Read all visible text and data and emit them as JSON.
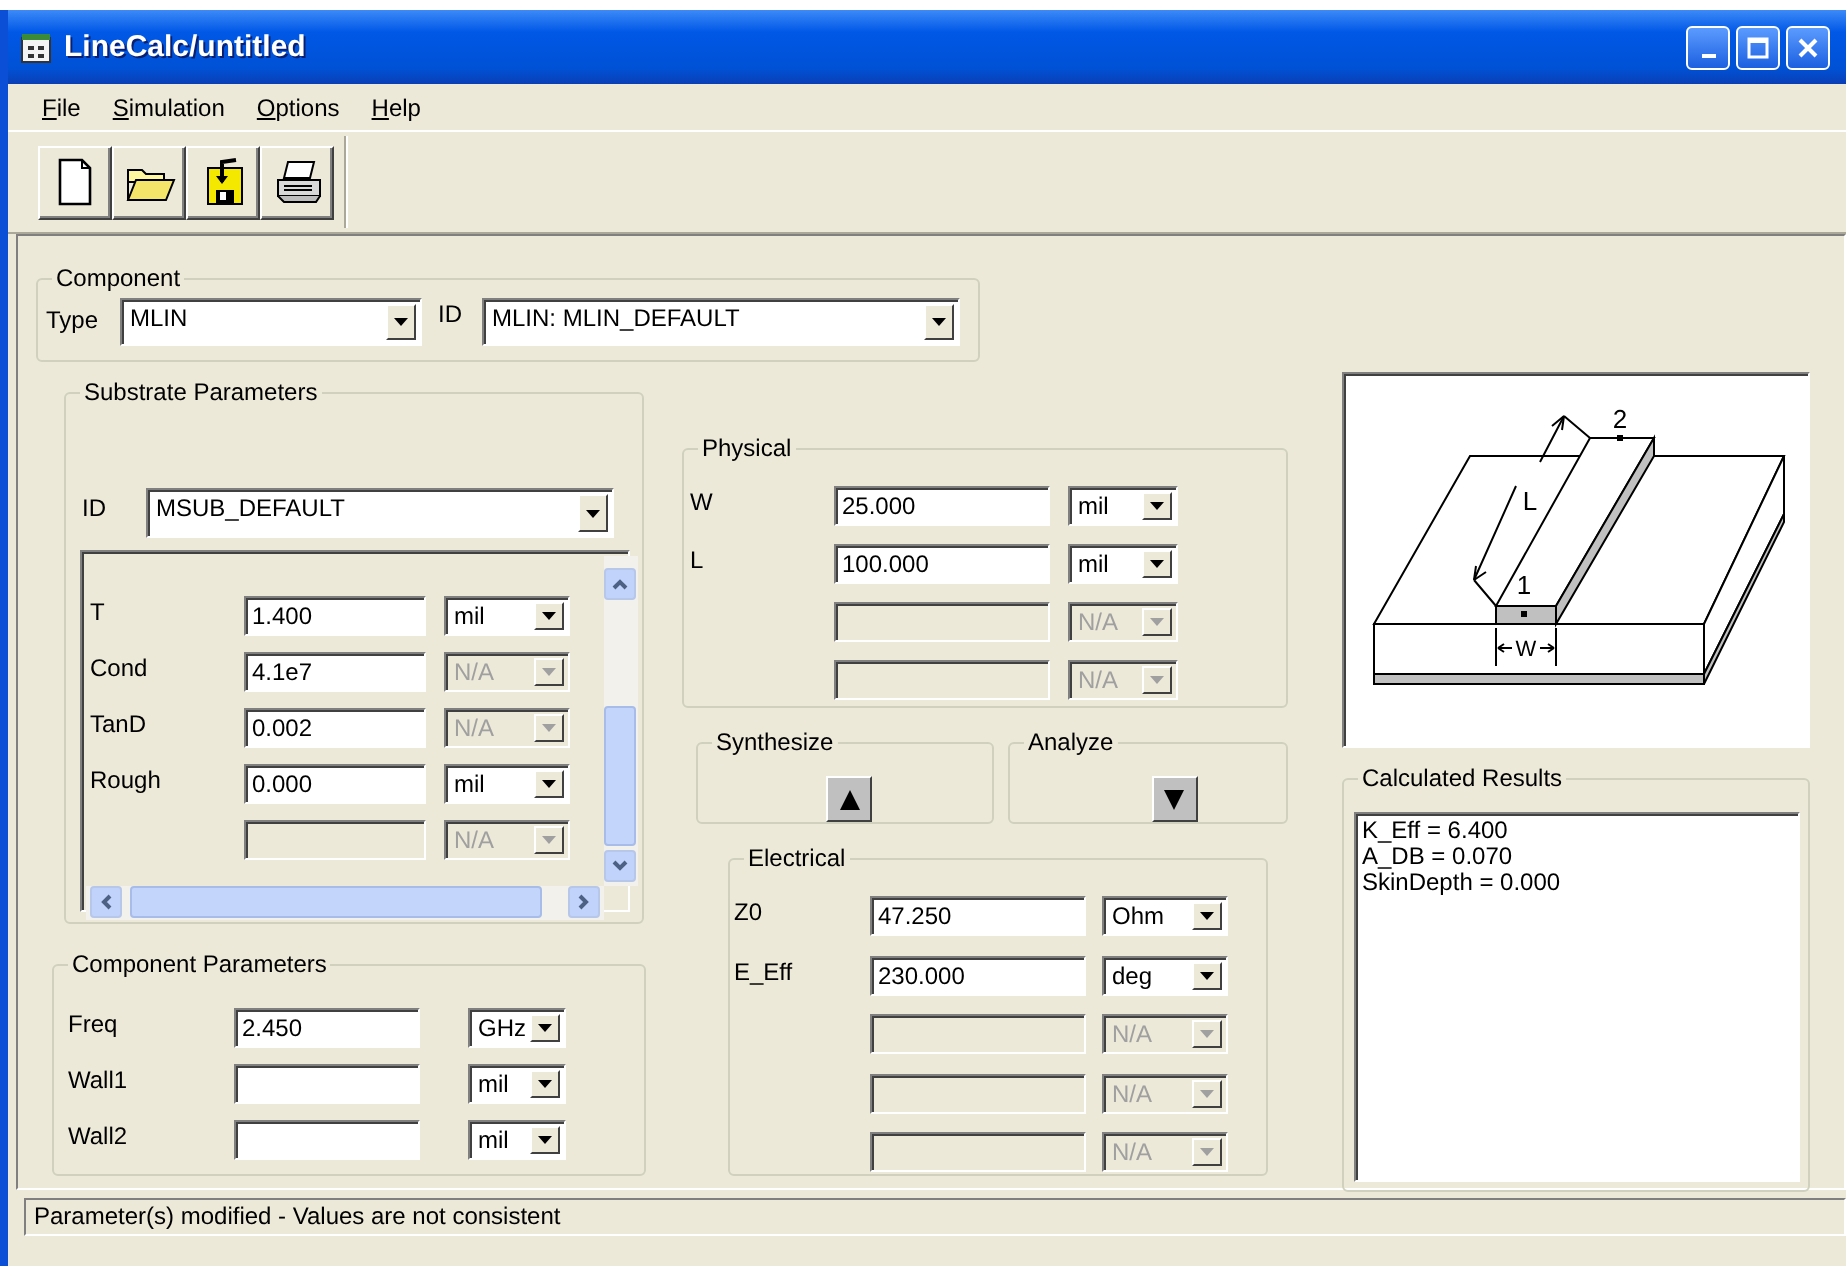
{
  "window": {
    "title": "LineCalc/untitled"
  },
  "menu": [
    {
      "label": "File"
    },
    {
      "label": "Simulation"
    },
    {
      "label": "Options"
    },
    {
      "label": "Help"
    }
  ],
  "component": {
    "title": "Component",
    "type_label": "Type",
    "type": "MLIN",
    "id_label": "ID",
    "id": "MLIN: MLIN_DEFAULT"
  },
  "substrate": {
    "title": "Substrate Parameters",
    "id_label": "ID",
    "id": "MSUB_DEFAULT",
    "rows": [
      {
        "label": "T",
        "value": "1.400",
        "unit": "mil",
        "value_disabled": false,
        "unit_disabled": false
      },
      {
        "label": "Cond",
        "value": "4.1e7",
        "unit": "N/A",
        "value_disabled": false,
        "unit_disabled": true
      },
      {
        "label": "TanD",
        "value": "0.002",
        "unit": "N/A",
        "value_disabled": false,
        "unit_disabled": true
      },
      {
        "label": "Rough",
        "value": "0.000",
        "unit": "mil",
        "value_disabled": false,
        "unit_disabled": false
      },
      {
        "unit": "N/A",
        "value_disabled": true,
        "unit_disabled": true
      }
    ]
  },
  "component_parameters": {
    "title": "Component Parameters",
    "rows": [
      {
        "label": "Freq",
        "value": "2.450",
        "unit": "GHz",
        "value_disabled": false,
        "unit_disabled": false
      },
      {
        "label": "Wall1",
        "unit": "mil",
        "value_disabled": false,
        "unit_disabled": false
      },
      {
        "label": "Wall2",
        "unit": "mil",
        "value_disabled": false,
        "unit_disabled": false
      }
    ]
  },
  "physical": {
    "title": "Physical",
    "rows": [
      {
        "label": "W",
        "value": "25.000",
        "unit": "mil",
        "value_disabled": false,
        "unit_disabled": false
      },
      {
        "label": "L",
        "value": "100.000",
        "unit": "mil",
        "value_disabled": false,
        "unit_disabled": false
      },
      {
        "unit": "N/A",
        "value_disabled": true,
        "unit_disabled": true
      },
      {
        "unit": "N/A",
        "value_disabled": true,
        "unit_disabled": true
      }
    ]
  },
  "synthesize": {
    "title": "Synthesize"
  },
  "analyze": {
    "title": "Analyze"
  },
  "electrical": {
    "title": "Electrical",
    "rows": [
      {
        "label": "Z0",
        "value": "47.250",
        "unit": "Ohm",
        "value_disabled": false,
        "unit_disabled": false
      },
      {
        "label": "E_Eff",
        "value": "230.000",
        "unit": "deg",
        "value_disabled": false,
        "unit_disabled": false
      },
      {
        "unit": "N/A",
        "value_disabled": true,
        "unit_disabled": true
      },
      {
        "unit": "N/A",
        "value_disabled": true,
        "unit_disabled": true
      },
      {
        "unit": "N/A",
        "value_disabled": true,
        "unit_disabled": true
      }
    ]
  },
  "diagram": {
    "labels": [
      "2",
      "L",
      "1",
      "W"
    ]
  },
  "results": {
    "title": "Calculated Results",
    "lines": [
      "K_Eff = 6.400",
      "A_DB = 0.070",
      "SkinDepth = 0.000"
    ]
  },
  "status_bar": "Parameter(s) modified - Values are not consistent"
}
